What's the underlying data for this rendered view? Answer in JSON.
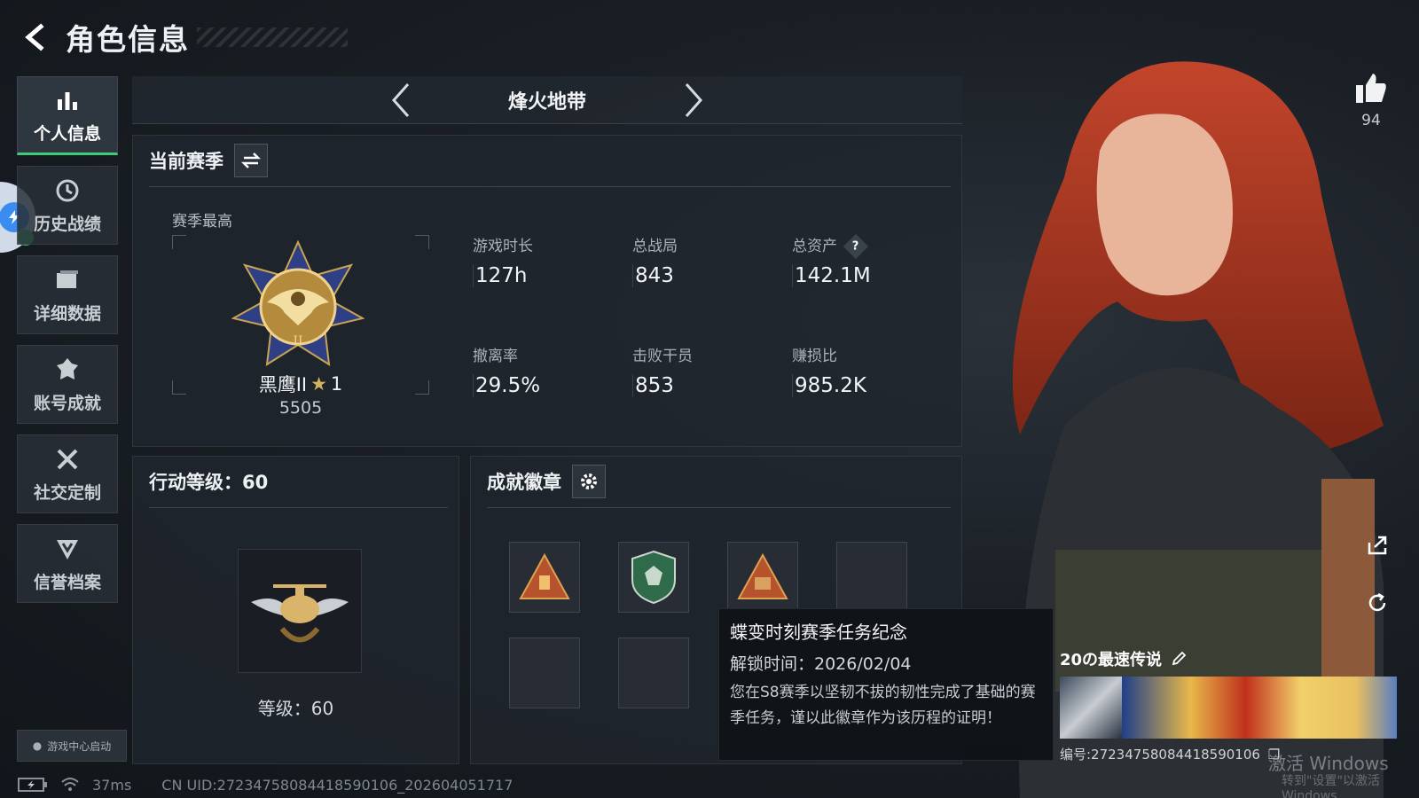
{
  "header": {
    "title": "角色信息"
  },
  "sidebar": {
    "items": [
      {
        "label": "个人信息",
        "icon": "bar-chart-icon",
        "active": true
      },
      {
        "label": "历史战绩",
        "icon": "history-icon"
      },
      {
        "label": "详细数据",
        "icon": "folder-icon"
      },
      {
        "label": "账号成就",
        "icon": "achievement-icon"
      },
      {
        "label": "社交定制",
        "icon": "tools-icon"
      },
      {
        "label": "信誉档案",
        "icon": "shield-icon"
      }
    ],
    "game_center": "游戏中心启动"
  },
  "mode_bar": {
    "name": "烽火地带"
  },
  "season": {
    "title": "当前赛季",
    "best_label": "赛季最高",
    "rank_name": "黑鹰II",
    "rank_stars": "1",
    "rank_points": "5505",
    "stats": [
      {
        "label": "游戏时长",
        "value": "127h"
      },
      {
        "label": "总战局",
        "value": "843"
      },
      {
        "label": "总资产",
        "value": "142.1M",
        "help": "?"
      },
      {
        "label": "撤离率",
        "value": "29.5%"
      },
      {
        "label": "击败干员",
        "value": "853"
      },
      {
        "label": "赚损比",
        "value": "985.2K"
      }
    ]
  },
  "action_level": {
    "title": "行动等级：60",
    "level_text": "等级：60"
  },
  "badges": {
    "title": "成就徽章",
    "tooltip": {
      "title": "蝶变时刻赛季任务纪念",
      "unlock": "解锁时间：2026/02/04",
      "desc": "您在S8赛季以坚韧不拔的韧性完成了基础的赛季任务，谨以此徽章作为该历程的证明！"
    }
  },
  "profile_card": {
    "title": "20の最速传说",
    "id": "编号:272347580844185901​06"
  },
  "likes": {
    "count": "94"
  },
  "watermark": {
    "line1": "激活 Windows",
    "line2": "转到\"设置\"以激活 Windows"
  },
  "status": {
    "ping": "37ms",
    "uid": "CN UID:27234758084418590106_202604051717"
  },
  "colors": {
    "accent_green": "#3ecb7b",
    "background": "#1a1f25"
  }
}
